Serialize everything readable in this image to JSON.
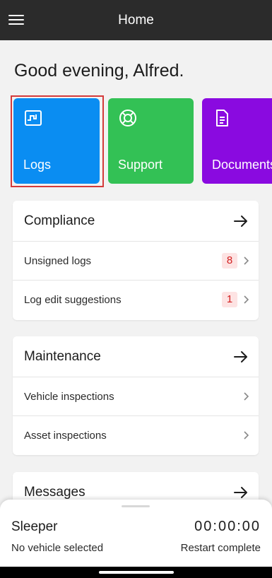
{
  "appbar": {
    "title": "Home"
  },
  "greeting": "Good evening, Alfred.",
  "tiles": [
    {
      "label": "Logs",
      "icon": "logs-icon",
      "color": "#0a8df2"
    },
    {
      "label": "Support",
      "icon": "lifebuoy-icon",
      "color": "#33c155"
    },
    {
      "label": "Documents",
      "icon": "document-icon",
      "color": "#8a0ae0"
    }
  ],
  "highlight_color": "#d43a3a",
  "compliance": {
    "title": "Compliance",
    "rows": [
      {
        "label": "Unsigned logs",
        "badge": "8"
      },
      {
        "label": "Log edit suggestions",
        "badge": "1"
      }
    ]
  },
  "maintenance": {
    "title": "Maintenance",
    "rows": [
      {
        "label": "Vehicle inspections"
      },
      {
        "label": "Asset inspections"
      }
    ]
  },
  "messages": {
    "title": "Messages"
  },
  "status_sheet": {
    "duty_status": "Sleeper",
    "timer": "00:00:00",
    "vehicle": "No vehicle selected",
    "restart": "Restart complete"
  }
}
